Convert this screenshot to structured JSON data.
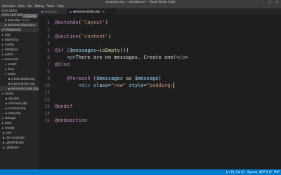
{
  "window": {
    "title": "ws.blade.php — vfvsdboard — Visual Studio Code"
  },
  "menu": [
    "Selection",
    "View",
    "Go",
    "Debug",
    "Tasks",
    "Help"
  ],
  "sidebar": {
    "header": "EXPLORER",
    "open_editors": {
      "label": "OPEN EDITORS",
      "badge": "1 UNSAVED",
      "items": [
        {
          "name": "web.php",
          "sub": "routes"
        },
        {
          "name": "welcome.blade.php",
          "sub": ""
        }
      ]
    },
    "project": {
      "label": "VFVSDBOARD"
    },
    "tree": [
      {
        "label": "app",
        "kind": "folder"
      },
      {
        "label": "bootstrap",
        "kind": "folder"
      },
      {
        "label": "config",
        "kind": "folder"
      },
      {
        "label": "database",
        "kind": "folder"
      },
      {
        "label": "public",
        "kind": "folder"
      },
      {
        "label": "resources",
        "kind": "folder-open"
      },
      {
        "label": "assets",
        "kind": "folder"
      },
      {
        "label": "lang",
        "kind": "folder"
      },
      {
        "label": "views",
        "kind": "folder-open"
      },
      {
        "label": "create.blade.php",
        "kind": "file"
      },
      {
        "label": "layout.blade.php",
        "kind": "file"
      },
      {
        "label": "welcome.blade.php",
        "kind": "file"
      },
      {
        "label": "routes",
        "kind": "folder-open"
      },
      {
        "label": "api.php",
        "kind": "file"
      },
      {
        "label": "channels.php",
        "kind": "file"
      },
      {
        "label": "console.php",
        "kind": "file"
      },
      {
        "label": "web.php",
        "kind": "file"
      },
      {
        "label": "storage",
        "kind": "folder"
      },
      {
        "label": "tests",
        "kind": "folder"
      },
      {
        "label": "vendor",
        "kind": "folder"
      },
      {
        "label": ".env",
        "kind": "file"
      },
      {
        "label": ".env.example",
        "kind": "file"
      },
      {
        "label": ".gitattributes",
        "kind": "file"
      },
      {
        "label": ".gitignore",
        "kind": "file"
      }
    ]
  },
  "tabs": [
    {
      "label": "web.php",
      "active": false
    },
    {
      "label": "welcome.blade.php",
      "active": true,
      "close": "×"
    }
  ],
  "editor": {
    "lines": [
      {
        "n": "1",
        "tokens": [
          [
            "kw",
            "@extends"
          ],
          [
            "txt",
            "("
          ],
          [
            "str",
            "'layout'"
          ],
          [
            "txt",
            ")"
          ]
        ]
      },
      {
        "n": "2",
        "tokens": []
      },
      {
        "n": "3",
        "tokens": [
          [
            "kw",
            "@section"
          ],
          [
            "txt",
            "("
          ],
          [
            "str",
            "'content'"
          ],
          [
            "txt",
            ")"
          ]
        ]
      },
      {
        "n": "4",
        "tokens": []
      },
      {
        "n": "5",
        "tokens": [
          [
            "kw",
            "@if"
          ],
          [
            "txt",
            " ("
          ],
          [
            "var",
            "$messages"
          ],
          [
            "txt",
            "→"
          ],
          [
            "fn",
            "isEmpty"
          ],
          [
            "txt",
            "())"
          ]
        ]
      },
      {
        "n": "6",
        "tokens": [
          [
            "txt",
            "    <"
          ],
          [
            "tag",
            "p"
          ],
          [
            "txt",
            ">There are no messages. Create one!</"
          ],
          [
            "tag",
            "p"
          ],
          [
            "txt",
            ">"
          ]
        ]
      },
      {
        "n": "7",
        "tokens": [
          [
            "kw",
            "@else"
          ]
        ]
      },
      {
        "n": "8",
        "tokens": []
      },
      {
        "n": "9",
        "tokens": [
          [
            "txt",
            "    "
          ],
          [
            "kw",
            "@foreach"
          ],
          [
            "txt",
            " ("
          ],
          [
            "var",
            "$messages"
          ],
          [
            "txt",
            " as "
          ],
          [
            "var",
            "$message"
          ],
          [
            "txt",
            ")"
          ]
        ]
      },
      {
        "n": "10",
        "tokens": [
          [
            "txt",
            "        <"
          ],
          [
            "tag",
            "div"
          ],
          [
            "txt",
            " "
          ],
          [
            "attr",
            "class"
          ],
          [
            "txt",
            "="
          ],
          [
            "str",
            "\"row\""
          ],
          [
            "txt",
            " "
          ],
          [
            "attr",
            "style"
          ],
          [
            "txt",
            "="
          ],
          [
            "str",
            "\"padding:"
          ]
        ],
        "cursor": true
      },
      {
        "n": "11",
        "tokens": []
      },
      {
        "n": "12",
        "tokens": []
      },
      {
        "n": "13",
        "tokens": [
          [
            "kw",
            "@endif"
          ]
        ]
      },
      {
        "n": "14",
        "tokens": []
      },
      {
        "n": "15",
        "tokens": [
          [
            "kw",
            "@endsection"
          ]
        ]
      }
    ]
  },
  "status": {
    "position": "Ln 10, Col 41",
    "spaces": "Spaces: 4",
    "encoding": "UTF-8",
    "eol": "LF",
    "lang": "PHP"
  },
  "colors": {
    "statusbar": "#007acc",
    "editor_bg": "#1e1e1e",
    "sidebar_bg": "#252526"
  }
}
